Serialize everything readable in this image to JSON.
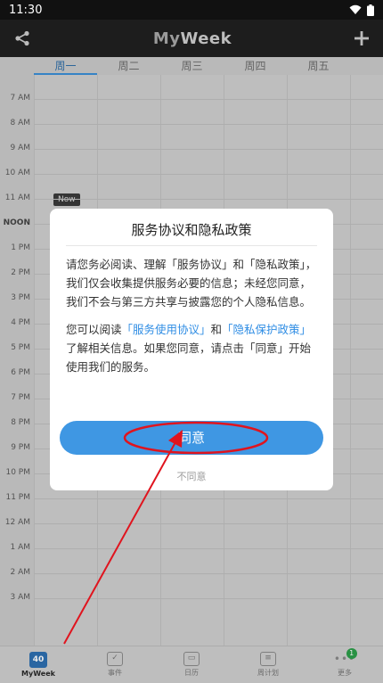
{
  "status_bar": {
    "time": "11:30"
  },
  "app_bar": {
    "title_my": "My",
    "title_week": "Week"
  },
  "week_days": [
    "周一",
    "周二",
    "周三",
    "周四",
    "周五"
  ],
  "time_labels": [
    "7 AM",
    "8 AM",
    "9 AM",
    "10 AM",
    "11 AM",
    "NOON",
    "1 PM",
    "2 PM",
    "3 PM",
    "4 PM",
    "5 PM",
    "6 PM",
    "7 PM",
    "8 PM",
    "9 PM",
    "10 PM",
    "11 PM",
    "12 AM",
    "1 AM",
    "2 AM",
    "3 AM"
  ],
  "now_badge": "Now",
  "dialog": {
    "title": "服务协议和隐私政策",
    "para1": "请您务必阅读、理解「服务协议」和「隐私政策」，我们仅会收集提供服务必要的信息；未经您同意，我们不会与第三方共享与披露您的个人隐私信息。",
    "para2_prefix": "您可以阅读",
    "link_terms": "「服务使用协议」",
    "para2_and": "和",
    "link_privacy": "「隐私保护政策」",
    "para2_suffix": "了解相关信息。如果您同意，请点击「同意」开始使用我们的服务。",
    "agree_label": "同意",
    "disagree_label": "不同意"
  },
  "bottom_nav": {
    "items": [
      {
        "label": "MyWeek",
        "glyph": "40"
      },
      {
        "label": "事件",
        "glyph": "✓"
      },
      {
        "label": "日历",
        "glyph": "▭"
      },
      {
        "label": "周计划",
        "glyph": "≡"
      },
      {
        "label": "更多",
        "badge": "1"
      }
    ]
  },
  "colors": {
    "accent": "#3f97e3",
    "link": "#2f8de4",
    "annotation": "#e0141e"
  }
}
